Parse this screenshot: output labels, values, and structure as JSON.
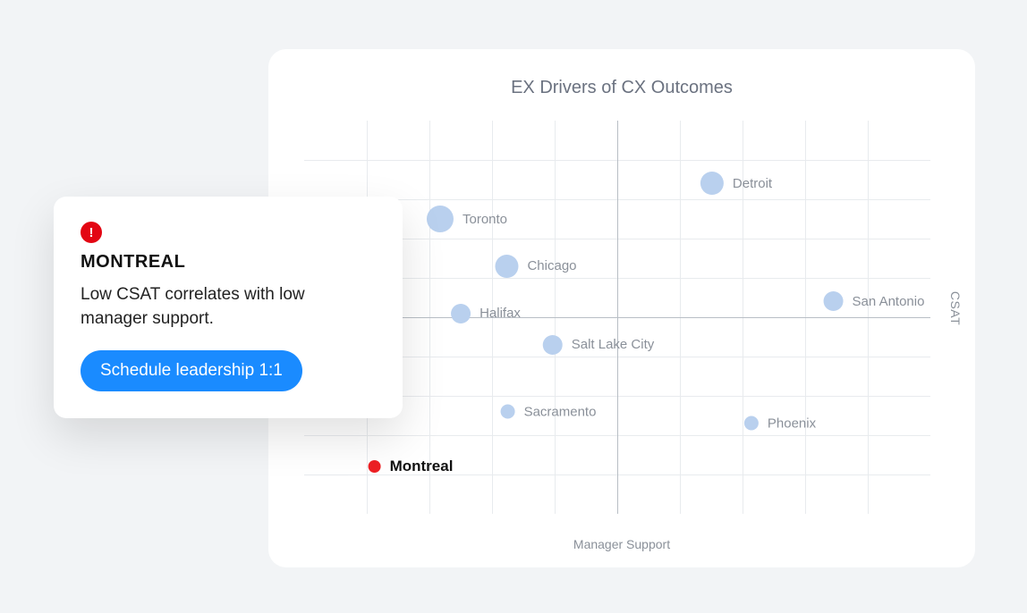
{
  "chart_data": {
    "type": "scatter",
    "title": "EX Drivers of CX Outcomes",
    "xlabel": "Manager Support",
    "ylabel": "CSAT",
    "xlim": [
      0,
      10
    ],
    "ylim": [
      0,
      10
    ],
    "x_axis_at": 5,
    "y_axis_at": 5,
    "points": [
      {
        "name": "Detroit",
        "x": 6.9,
        "y": 8.4,
        "size": 26,
        "highlight": false
      },
      {
        "name": "Toronto",
        "x": 2.6,
        "y": 7.5,
        "size": 30,
        "highlight": false
      },
      {
        "name": "Chicago",
        "x": 3.7,
        "y": 6.3,
        "size": 26,
        "highlight": false
      },
      {
        "name": "San Antonio",
        "x": 9.1,
        "y": 5.4,
        "size": 22,
        "highlight": false
      },
      {
        "name": "Halifax",
        "x": 2.9,
        "y": 5.1,
        "size": 22,
        "highlight": false
      },
      {
        "name": "Salt Lake City",
        "x": 4.7,
        "y": 4.3,
        "size": 22,
        "highlight": false
      },
      {
        "name": "Sacramento",
        "x": 3.9,
        "y": 2.6,
        "size": 16,
        "highlight": false
      },
      {
        "name": "Phoenix",
        "x": 7.6,
        "y": 2.3,
        "size": 16,
        "highlight": false
      },
      {
        "name": "Montreal",
        "x": 1.7,
        "y": 1.2,
        "size": 14,
        "highlight": true
      }
    ]
  },
  "insight": {
    "title": "MONTREAL",
    "body": "Low CSAT correlates with low manager support.",
    "cta_label": "Schedule leadership 1:1"
  }
}
